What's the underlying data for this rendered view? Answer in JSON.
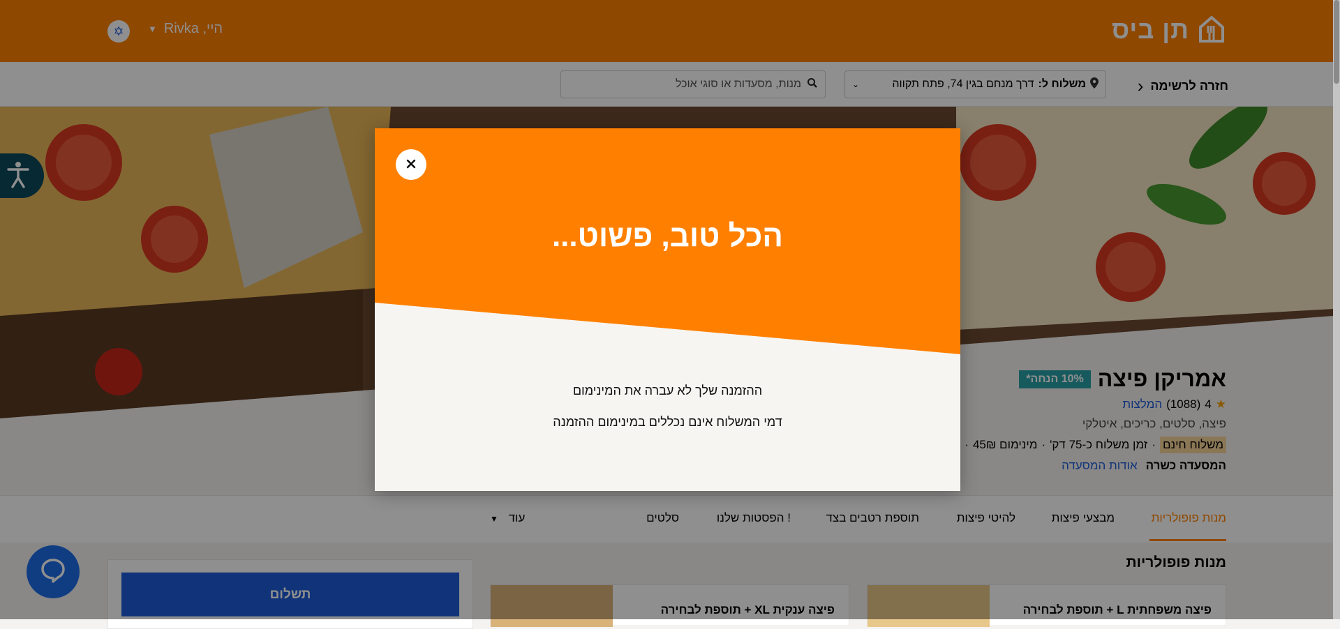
{
  "header": {
    "logo_text": "תן ביס",
    "user_greeting": "היי, Rivka",
    "lang_icon": "israel-flag-icon"
  },
  "subbar": {
    "back_label": "חזרה לרשימה",
    "delivery_prefix": "משלוח ל:",
    "delivery_address": "דרך מנחם בגין 74, פתח תקווה",
    "search_placeholder": "מנות, מסעדות או סוגי אוכל"
  },
  "restaurant": {
    "name": "אמריקן פיצה",
    "discount_badge": "10% הנחה*",
    "rating": "4",
    "reviews_count": "(1088)",
    "reviews_link": "המלצות",
    "cuisines": "פיצה, סלטים, כריכים, איטלקי",
    "free_delivery": "משלוח חינם",
    "delivery_time": "זמן משלוח כ-75 דק'",
    "minimum": "מינימום 45₪",
    "kosher": "המסעדה כשרה",
    "about_link": "אודות המסעדה"
  },
  "tabs": [
    "מנות פופולריות",
    "מבצעי פיצות",
    "להיטי פיצות",
    "תוספת רטבים בצד",
    "הפסטות שלנו !",
    "סלטים"
  ],
  "more_tab": "עוד",
  "section_title": "מנות פופולריות",
  "cards": [
    "פיצה משפחתית L + תוספת לבחירה",
    "פיצה ענקית XL + תוספת לבחירה"
  ],
  "pay_button": "תשלום",
  "modal": {
    "title": "הכל טוב, פשוט...",
    "line1": "ההזמנה שלך לא עברה את המינימום",
    "line2": "דמי המשלוח אינם נכללים במינימום ההזמנה"
  },
  "colors": {
    "brand_orange": "#ff8000",
    "pay_blue": "#1e5bd8",
    "badge_teal": "#2aa1a8"
  }
}
